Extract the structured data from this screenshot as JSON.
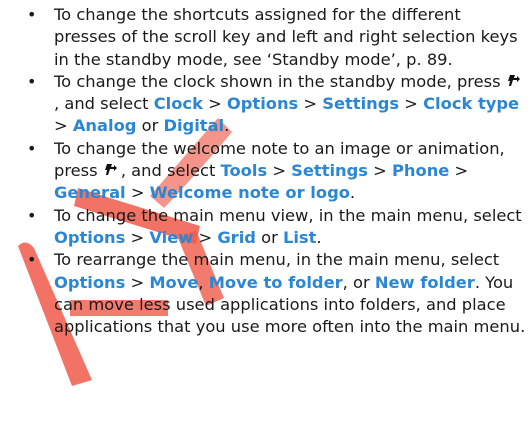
{
  "items": [
    [
      {
        "t": "text",
        "v": "To change the shortcuts assigned for the different presses of the scroll key and left and right selection keys in the standby mode, see ‘Standby mode’, p. 89."
      }
    ],
    [
      {
        "t": "text",
        "v": "To change the clock shown in the standby mode, press "
      },
      {
        "t": "icon",
        "name": "menu-key-icon"
      },
      {
        "t": "text",
        "v": ", and select "
      },
      {
        "t": "link",
        "v": "Clock"
      },
      {
        "t": "sep",
        "v": " > "
      },
      {
        "t": "link",
        "v": "Options"
      },
      {
        "t": "sep",
        "v": " > "
      },
      {
        "t": "link",
        "v": "Settings"
      },
      {
        "t": "sep",
        "v": " > "
      },
      {
        "t": "link",
        "v": "Clock type"
      },
      {
        "t": "sep",
        "v": " > "
      },
      {
        "t": "link",
        "v": "Analog"
      },
      {
        "t": "text",
        "v": " or "
      },
      {
        "t": "link",
        "v": "Digital"
      },
      {
        "t": "text",
        "v": "."
      }
    ],
    [
      {
        "t": "text",
        "v": "To change the welcome note to an image or animation, press "
      },
      {
        "t": "icon",
        "name": "menu-key-icon"
      },
      {
        "t": "text",
        "v": ", and select "
      },
      {
        "t": "link",
        "v": "Tools"
      },
      {
        "t": "sep",
        "v": " > "
      },
      {
        "t": "link",
        "v": "Settings"
      },
      {
        "t": "sep",
        "v": " > "
      },
      {
        "t": "link",
        "v": "Phone"
      },
      {
        "t": "sep",
        "v": " > "
      },
      {
        "t": "link",
        "v": "General"
      },
      {
        "t": "sep",
        "v": " > "
      },
      {
        "t": "link",
        "v": "Welcome note or logo"
      },
      {
        "t": "text",
        "v": "."
      }
    ],
    [
      {
        "t": "text",
        "v": "To change the main menu view, in the main menu, select "
      },
      {
        "t": "link",
        "v": "Options"
      },
      {
        "t": "sep",
        "v": " > "
      },
      {
        "t": "link",
        "v": "View"
      },
      {
        "t": "sep",
        "v": " > "
      },
      {
        "t": "link",
        "v": "Grid"
      },
      {
        "t": "text",
        "v": " or "
      },
      {
        "t": "link",
        "v": "List"
      },
      {
        "t": "text",
        "v": "."
      }
    ],
    [
      {
        "t": "text",
        "v": "To rearrange the main menu, in the main menu, select "
      },
      {
        "t": "link",
        "v": "Options"
      },
      {
        "t": "sep",
        "v": " > "
      },
      {
        "t": "link",
        "v": "Move"
      },
      {
        "t": "text",
        "v": ", "
      },
      {
        "t": "link",
        "v": "Move to folder"
      },
      {
        "t": "text",
        "v": ", or "
      },
      {
        "t": "link",
        "v": "New folder"
      },
      {
        "t": "text",
        "v": ". You can move less used applications into folders, and place applications that you use more often into the main menu."
      }
    ]
  ],
  "bullet": "•",
  "colors": {
    "link": "#2b86d3",
    "text": "#1a1a1a",
    "watermark": "#f05a4a"
  }
}
